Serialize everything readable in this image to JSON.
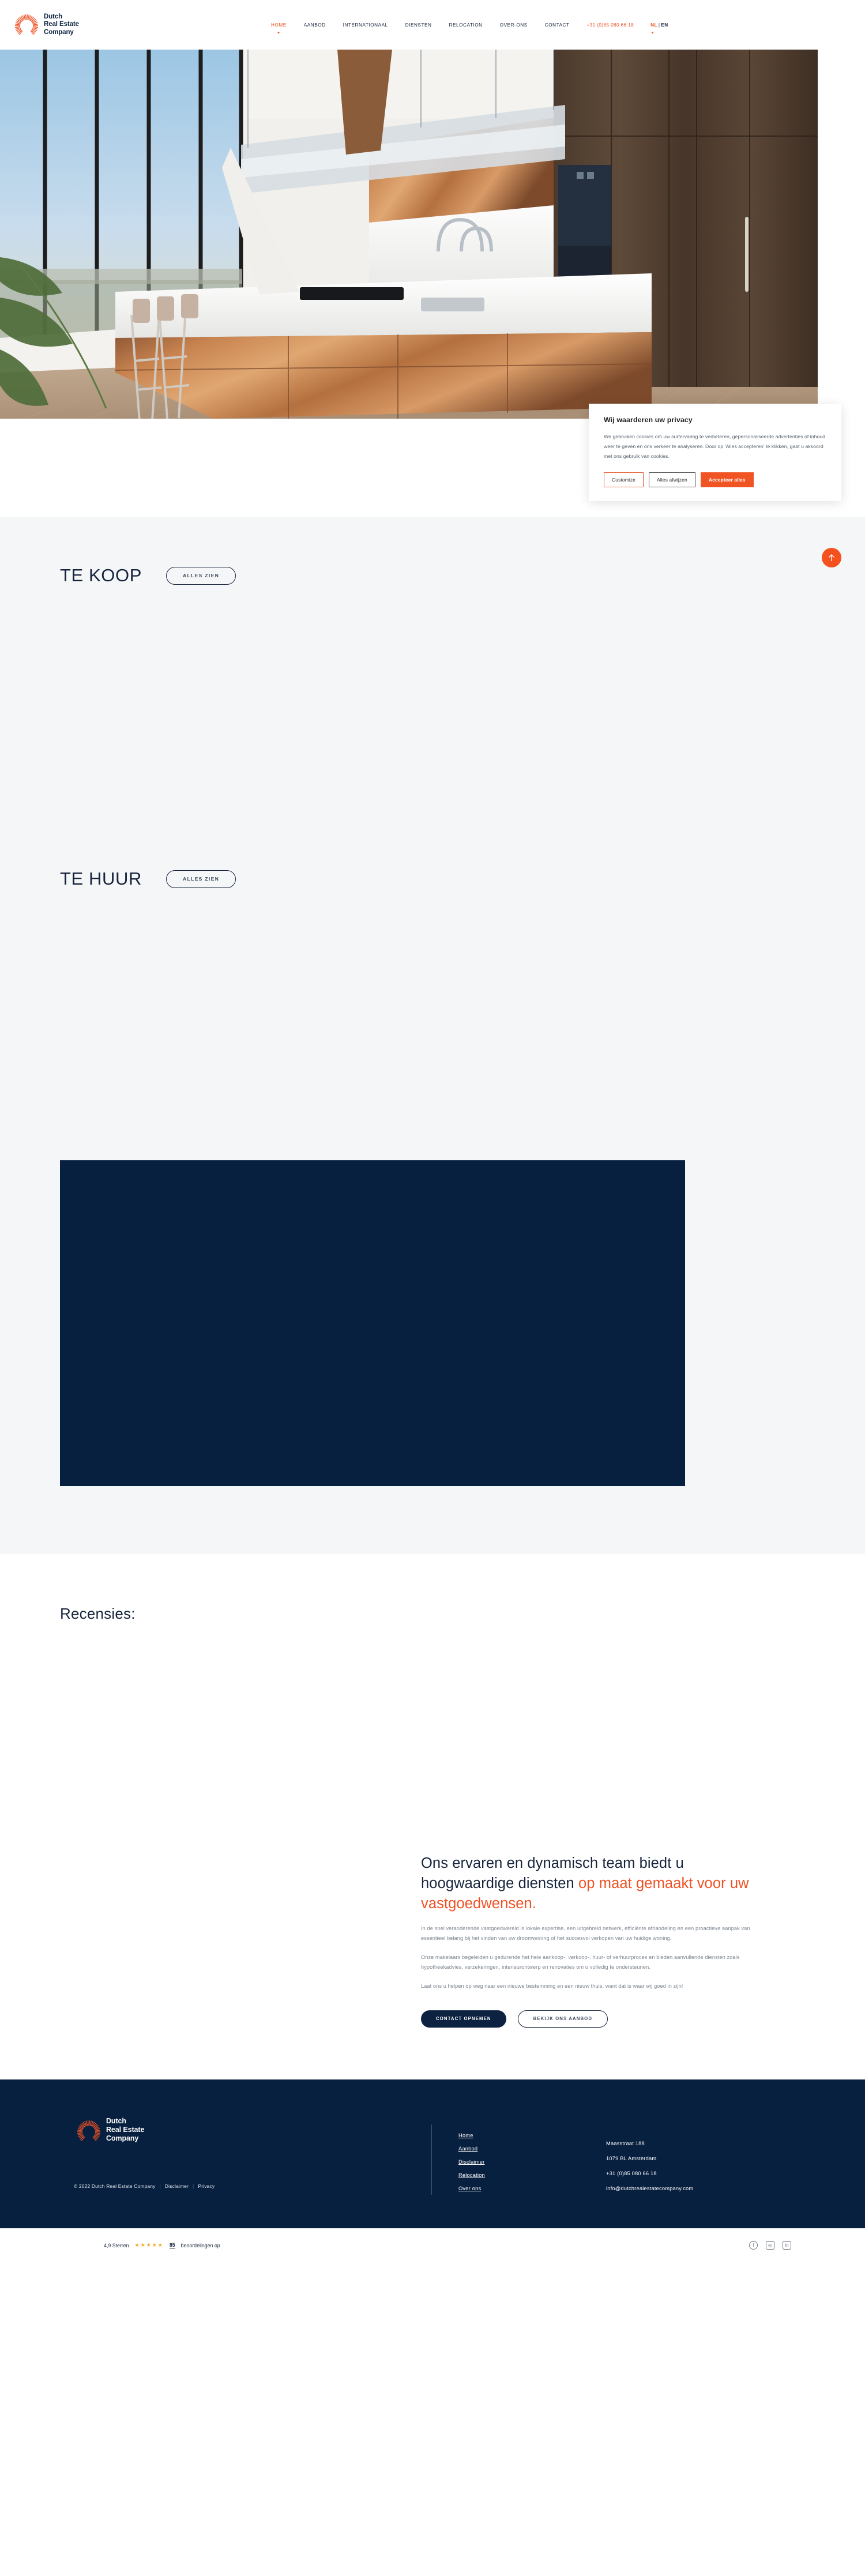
{
  "brand": {
    "name_line1": "Dutch",
    "name_line2": "Real Estate",
    "name_line3": "Company",
    "logo_icon": "sunburst-arch-icon",
    "accent_color": "#ef5123",
    "navy_color": "#08203f"
  },
  "header": {
    "nav_items": [
      {
        "label": "HOME",
        "active": true
      },
      {
        "label": "AANBOD",
        "active": false
      },
      {
        "label": "INTERNATIONAAL",
        "active": false
      },
      {
        "label": "DIENSTEN",
        "active": false
      },
      {
        "label": "RELOCATION",
        "active": false
      },
      {
        "label": "OVER-ONS",
        "active": false
      },
      {
        "label": "CONTACT",
        "active": false
      }
    ],
    "phone": "+31 (0)85 080 66 18",
    "lang_nl": "NL",
    "lang_sep": "|",
    "lang_en": "EN"
  },
  "hero": {
    "alt": "Luxury modern kitchen with copper cabinetry, white marble island and floor-to-ceiling windows overlooking a city skyline"
  },
  "sections": {
    "koop": {
      "title": "TE KOOP",
      "button": "ALLES ZIEN"
    },
    "huur": {
      "title": "TE HUUR",
      "button": "ALLES ZIEN"
    },
    "reviews": {
      "title": "Recensies:"
    }
  },
  "about": {
    "heading_plain": "Ons ervaren en dynamisch team biedt u hoogwaardige diensten ",
    "heading_accent": "op maat gemaakt voor uw vastgoedwensen.",
    "paragraphs": [
      "In de snel veranderende vastgoedwereld is lokale expertise, een uitgebreid netwerk, efficiënte afhandeling en een proactieve aanpak van essentieel belang bij het vinden van uw droomwoning of het succesvol verkopen van uw huidige woning.",
      "Onze makelaars begeleiden u gedurende het hele aankoop-, verkoop-, huur- of verhuurproces en bieden aanvullende diensten zoals hypotheekadvies, verzekeringen, interieurontwerp en renovaties om u volledig te ondersteunen.",
      "Laat ons u helpen op weg naar een nieuwe bestemming en een nieuw thuis, want dat is waar wij goed in zijn!"
    ],
    "btn_primary": "CONTACT OPNEMEN",
    "btn_secondary": "BEKIJK ONS AANBOD"
  },
  "cookie": {
    "title": "Wij waarderen uw privacy",
    "body": "We gebruiken cookies om uw surfervaring te verbeteren, gepersonaliseerde advertenties of inhoud weer te geven en ons verkeer te analyseren. Door op ‘Alles accepteren’ te klikken, gaat u akkoord met ons gebruik van cookies.",
    "btn_customize": "Customize",
    "btn_reject": "Alles afwijzen",
    "btn_accept": "Accepteer alles"
  },
  "scroll_top": {
    "icon": "arrow-up-icon"
  },
  "footer": {
    "copyright": "© 2022 Dutch Real Estate Company",
    "copy_links": [
      "Disclaimer",
      "Privacy"
    ],
    "links": [
      "Home",
      "Aanbod",
      "Disclaimer",
      "Relocation",
      "Over ons"
    ],
    "contact": [
      "Maasstraat 188",
      "1079 BL Amsterdam",
      "+31 (0)85 080 66 18",
      "info@dutchrealestatecompany.com"
    ]
  },
  "bottom_bar": {
    "rating_score": "4,9 Sterren",
    "stars": "★★★★★",
    "review_count": "85",
    "review_label": "beoordelingen op",
    "socials": [
      {
        "name": "facebook-icon",
        "glyph": "f"
      },
      {
        "name": "instagram-icon",
        "glyph": "◎"
      },
      {
        "name": "linkedin-icon",
        "glyph": "in"
      }
    ]
  }
}
